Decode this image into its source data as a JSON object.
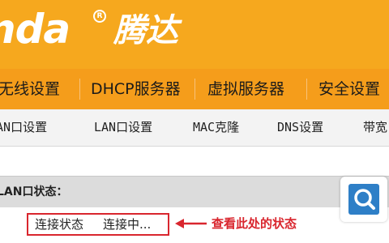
{
  "header": {
    "brand_latin": "nda",
    "reg_mark": "R",
    "brand_cn": "腾达",
    "colors": {
      "band": "#f6a81e",
      "logo": "#ffffff"
    }
  },
  "primary_nav": {
    "items": [
      {
        "label": "无线设置"
      },
      {
        "label": "DHCP服务器"
      },
      {
        "label": "虚拟服务器"
      },
      {
        "label": "安全设置"
      }
    ],
    "colors": {
      "background": "#f59d1b",
      "text": "#1a1a1a"
    }
  },
  "sub_nav": {
    "items": [
      {
        "label": "WAN口设置"
      },
      {
        "label": "LAN口设置"
      },
      {
        "label": "MAC克隆"
      },
      {
        "label": "DNS设置"
      },
      {
        "label": "带宽"
      }
    ]
  },
  "section": {
    "title": "LAN口状态："
  },
  "status": {
    "label": "连接状态",
    "value": "连接中...",
    "highlight_color": "#d9262e"
  },
  "annotation": {
    "text": "查看此处的状态",
    "color": "#d9262e"
  },
  "search_button": {
    "icon": "search-icon",
    "color": "#2e7fc7"
  }
}
